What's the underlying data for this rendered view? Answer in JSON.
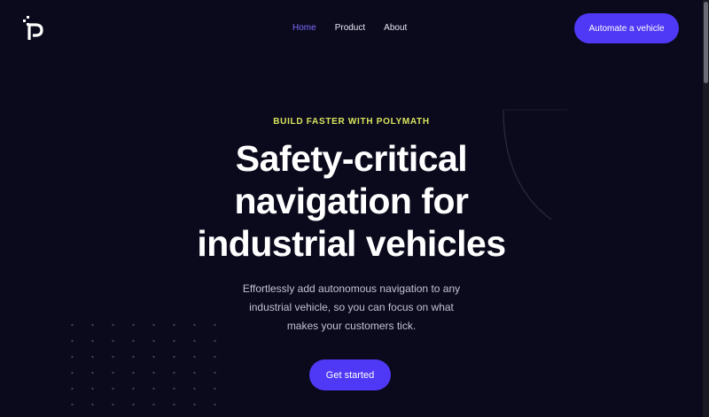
{
  "header": {
    "logo_icon": "polymath-p-logo-icon",
    "nav": [
      {
        "label": "Home",
        "active": true
      },
      {
        "label": "Product",
        "active": false
      },
      {
        "label": "About",
        "active": false
      }
    ],
    "cta_label": "Automate a vehicle"
  },
  "hero": {
    "eyebrow": "BUILD FASTER WITH POLYMATH",
    "headline_lines": [
      "Safety-critical",
      "navigation for",
      "industrial vehicles"
    ],
    "subtext_lines": [
      "Effortlessly add autonomous navigation to any",
      "industrial vehicle, so you can focus on what",
      "makes your customers tick."
    ],
    "button_label": "Get started"
  },
  "colors": {
    "background": "#0b0a1d",
    "accent": "#4f39f6",
    "nav_active": "#7c6cff",
    "eyebrow": "#d8e45c"
  }
}
